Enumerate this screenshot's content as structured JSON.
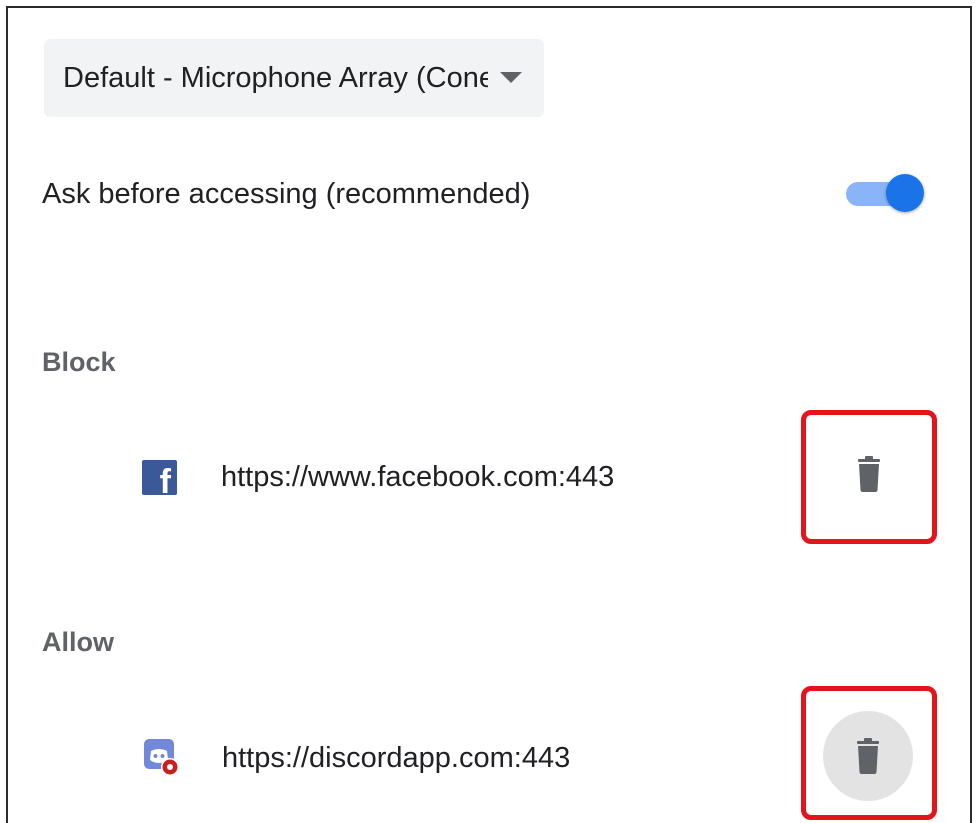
{
  "microphone_select": {
    "selected_value": "Default - Microphone Array (Conexant SmartAudio HD)"
  },
  "ask_setting": {
    "label": "Ask before accessing (recommended)",
    "enabled": true
  },
  "block": {
    "heading": "Block",
    "sites": [
      {
        "url": "https://www.facebook.com:443",
        "icon": "facebook-icon"
      }
    ]
  },
  "allow": {
    "heading": "Allow",
    "sites": [
      {
        "url": "https://discordapp.com:443",
        "icon": "discord-icon"
      }
    ]
  },
  "colors": {
    "accent": "#1a73e8",
    "highlight": "#e3141b",
    "facebook": "#3b5998",
    "discord": "#7289da"
  }
}
